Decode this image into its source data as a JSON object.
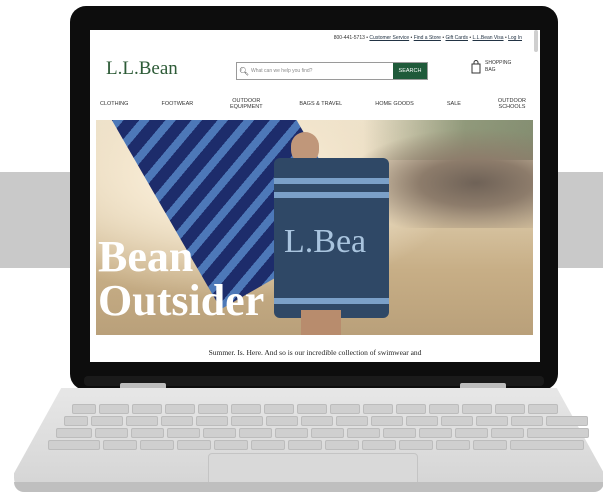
{
  "header": {
    "utility_links": [
      "800-441-5713",
      "Customer Service",
      "Find a Store",
      "Gift Cards",
      "L.L.Bean Visa",
      "Log In"
    ],
    "logo": "L.L.Bean",
    "search": {
      "placeholder": "What can we help you find?",
      "button_label": "SEARCH"
    },
    "bag": {
      "label": "SHOPPING BAG"
    }
  },
  "nav": {
    "items": [
      "CLOTHING",
      "FOOTWEAR",
      "OUTDOOR EQUIPMENT",
      "BAGS & TRAVEL",
      "HOME GOODS",
      "SALE",
      "OUTDOOR SCHOOLS"
    ]
  },
  "hero": {
    "headline_line1": "Bean",
    "headline_line2": "Outsider",
    "towel_text": "L.Bea"
  },
  "tagline": "Summer. Is. Here. And so is our incredible collection of swimwear and"
}
